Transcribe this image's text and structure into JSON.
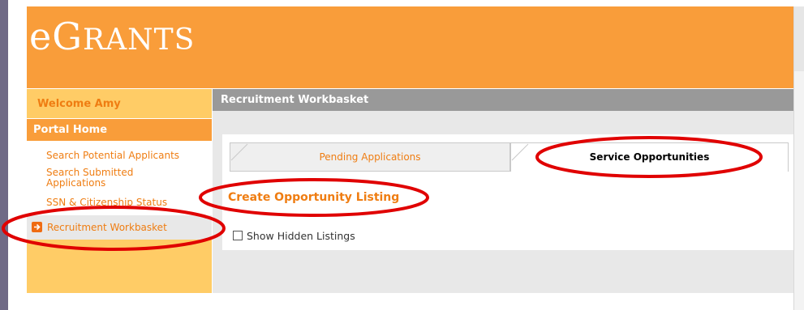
{
  "app": {
    "logo_initial": "e",
    "logo_big": "G",
    "logo_small": "RANTS"
  },
  "sidebar": {
    "welcome": "Welcome Amy",
    "portal_home": "Portal Home",
    "links": [
      {
        "label": "Search Potential Applicants"
      },
      {
        "label": "Search Submitted"
      },
      {
        "label": "Applications"
      },
      {
        "label": "SSN & Citizenship Status"
      }
    ],
    "active_item": "Recruitment Workbasket"
  },
  "main": {
    "title": "Recruitment Workbasket",
    "tabs": [
      {
        "label": "Pending Applications",
        "selected": false
      },
      {
        "label": "Service Opportunities",
        "selected": true
      }
    ],
    "create_link": "Create Opportunity Listing",
    "show_hidden_label": "Show Hidden Listings",
    "show_hidden_checked": false
  },
  "colors": {
    "header_orange": "#f99d3a",
    "link_orange": "#ef7d12",
    "sidebar_yellow": "#ffcc66",
    "annotation_red": "#e00000"
  },
  "icons": {
    "active_item_icon": "arrow-right-icon"
  }
}
